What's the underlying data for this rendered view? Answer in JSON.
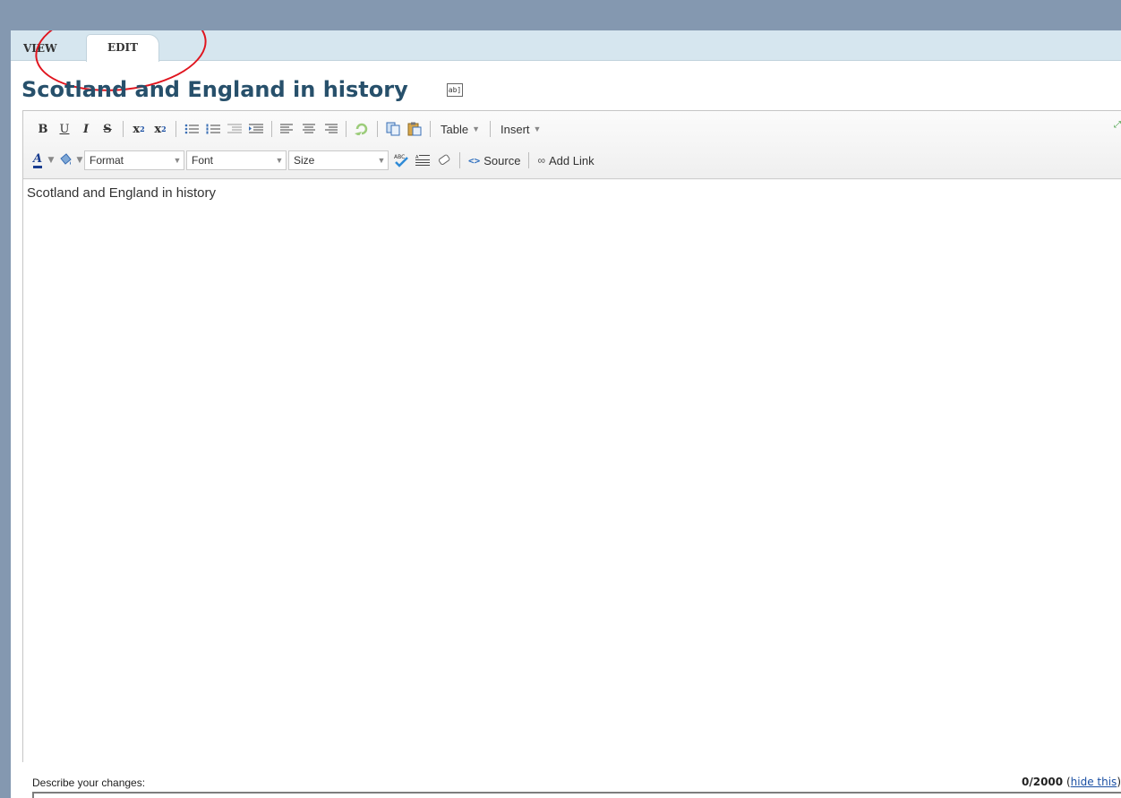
{
  "tabs": {
    "view": "VIEW",
    "edit": "EDIT"
  },
  "page": {
    "title": "Scotland and England in history",
    "rename_icon_text": "ab]"
  },
  "toolbar": {
    "row1": {
      "bold": "B",
      "underline": "U",
      "italic": "I",
      "strike": "S",
      "subscript": "x",
      "superscript": "x",
      "table_menu": "Table",
      "insert_menu": "Insert"
    },
    "row2": {
      "format": "Format",
      "font": "Font",
      "size": "Size",
      "source": "Source",
      "add_link": "Add Link"
    }
  },
  "editor": {
    "content": "Scotland and England in history"
  },
  "footer": {
    "describe_label": "Describe your changes:",
    "counter": "0/2000",
    "hide_link": "hide this",
    "describe_value": ""
  },
  "colors": {
    "background": "#8498b0",
    "tabbar": "#d6e6ef",
    "title": "#27506b",
    "annotation": "#e0141e",
    "link": "#1a4fa3"
  }
}
